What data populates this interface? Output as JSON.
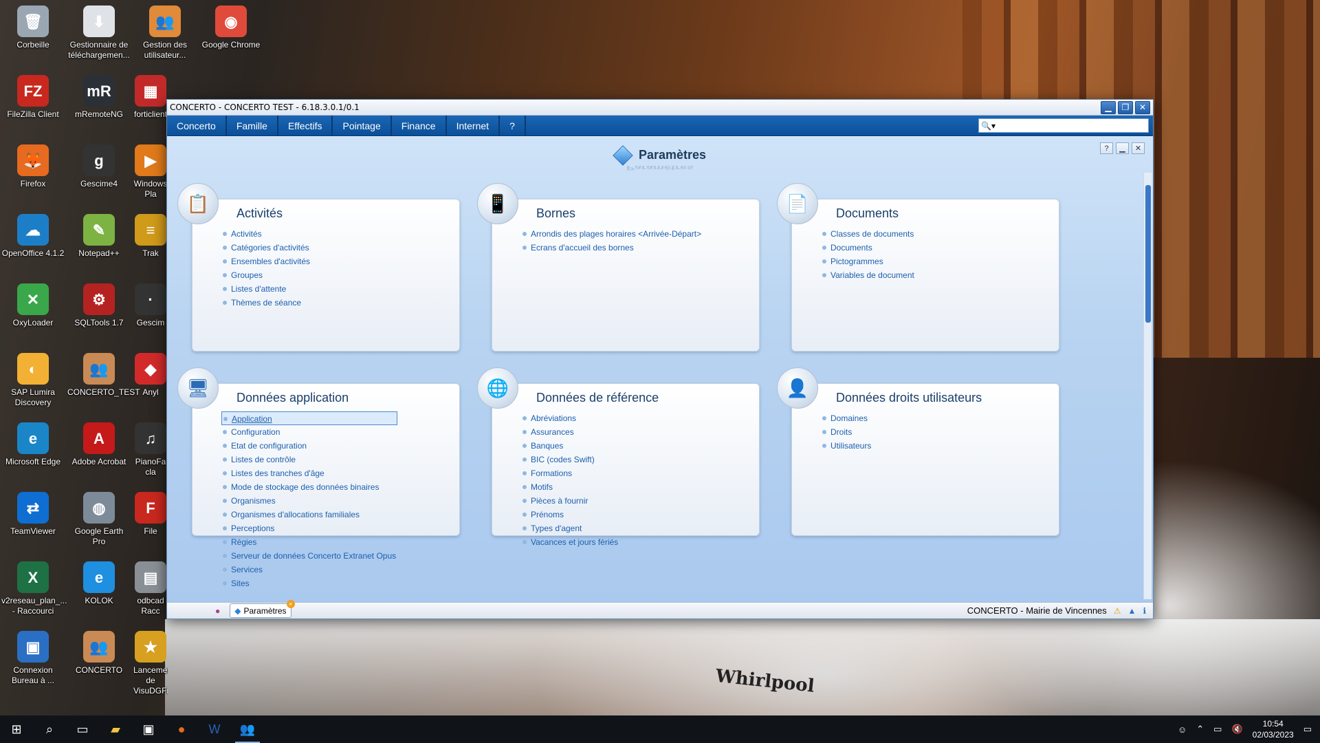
{
  "desktop": {
    "icons": [
      {
        "label": "Corbeille",
        "glyph": "🗑",
        "color": "#9aa7b3"
      },
      {
        "label": "Gestionnaire de téléchargemen...",
        "glyph": "⬇",
        "color": "#dfe3e8"
      },
      {
        "label": "Gestion des utilisateur...",
        "glyph": "👥",
        "color": "#e08a3a"
      },
      {
        "label": "Google Chrome",
        "glyph": "◉",
        "color": "#e04a3a"
      },
      {
        "label": "FileZilla Client",
        "glyph": "FZ",
        "color": "#c8281e"
      },
      {
        "label": "mRemoteNG",
        "glyph": "mR",
        "color": "#2b2f36"
      },
      {
        "label": "forticlient",
        "glyph": "▦",
        "color": "#c22a2a"
      },
      {
        "label": "Firefox",
        "glyph": "🦊",
        "color": "#e66a1f"
      },
      {
        "label": "Gescime4",
        "glyph": "g",
        "color": "#333333"
      },
      {
        "label": "Windows Pla",
        "glyph": "▶",
        "color": "#e07a1a"
      },
      {
        "label": "OpenOffice 4.1.2",
        "glyph": "☁",
        "color": "#1d7ec8"
      },
      {
        "label": "Notepad++",
        "glyph": "✎",
        "color": "#7cb342"
      },
      {
        "label": "Trak",
        "glyph": "≡",
        "color": "#d09a1a"
      },
      {
        "label": "OxyLoader",
        "glyph": "✕",
        "color": "#3aa84a"
      },
      {
        "label": "SQLTools 1.7",
        "glyph": "⚙",
        "color": "#b52222"
      },
      {
        "label": "Gescim",
        "glyph": "·",
        "color": "#333333"
      },
      {
        "label": "SAP Lumira Discovery",
        "glyph": "◐",
        "color": "#f2b134"
      },
      {
        "label": "CONCERTO_TEST",
        "glyph": "👥",
        "color": "#c98a55"
      },
      {
        "label": "Anyl",
        "glyph": "◆",
        "color": "#d22a2a"
      },
      {
        "label": "Microsoft Edge",
        "glyph": "e",
        "color": "#1a86c8"
      },
      {
        "label": "Adobe Acrobat",
        "glyph": "A",
        "color": "#c41a1a"
      },
      {
        "label": "PianoFa cla",
        "glyph": "♫",
        "color": "#333333"
      },
      {
        "label": "TeamViewer",
        "glyph": "⇄",
        "color": "#0e6ed1"
      },
      {
        "label": "Google Earth Pro",
        "glyph": "◍",
        "color": "#7d8b99"
      },
      {
        "label": "File",
        "glyph": "F",
        "color": "#c8281e"
      },
      {
        "label": "v2reseau_plan_... - Raccourci",
        "glyph": "X",
        "color": "#1e7145"
      },
      {
        "label": "KOLOK",
        "glyph": "e",
        "color": "#1f8fe0"
      },
      {
        "label": "odbcad Racc",
        "glyph": "▤",
        "color": "#8a8f96"
      },
      {
        "label": "Connexion Bureau à ...",
        "glyph": "▣",
        "color": "#2a6fc4"
      },
      {
        "label": "CONCERTO",
        "glyph": "👥",
        "color": "#c98a55"
      },
      {
        "label": "Lancement de VisuDGFiP",
        "glyph": "★",
        "color": "#d8a020"
      }
    ]
  },
  "window": {
    "title": "CONCERTO - CONCERTO TEST - 6.18.3.0.1/0.1",
    "menu": [
      "Concerto",
      "Famille",
      "Effectifs",
      "Pointage",
      "Finance",
      "Internet",
      "?"
    ],
    "search": {
      "value": "",
      "icon": "search-icon"
    },
    "page_title": "Paramètres",
    "panels": [
      {
        "title": "Activités",
        "icon": "📋",
        "items": [
          "Activités",
          "Catégories d'activités",
          "Ensembles d'activités",
          "Groupes",
          "Listes d'attente",
          "Thèmes de séance"
        ]
      },
      {
        "title": "Bornes",
        "icon": "📱",
        "items": [
          "Arrondis des plages horaires <Arrivée-Départ>",
          "Ecrans d'accueil des bornes"
        ]
      },
      {
        "title": "Documents",
        "icon": "📄",
        "items": [
          "Classes de documents",
          "Documents",
          "Pictogrammes",
          "Variables de document"
        ]
      },
      {
        "title": "Données application",
        "icon": "🖥",
        "selected": "Application",
        "items": [
          "Application",
          "Configuration",
          "Etat de configuration",
          "Listes de contrôle",
          "Listes des tranches d'âge",
          "Mode de stockage des données binaires",
          "Organismes",
          "Organismes d'allocations familiales",
          "Perceptions",
          "Régies",
          "Serveur de données Concerto Extranet Opus",
          "Services",
          "Sites"
        ]
      },
      {
        "title": "Données de référence",
        "icon": "🌐",
        "items": [
          "Abréviations",
          "Assurances",
          "Banques",
          "BIC (codes Swift)",
          "Formations",
          "Motifs",
          "Pièces à fournir",
          "Prénoms",
          "Types d'agent",
          "Vacances et jours fériés"
        ]
      },
      {
        "title": "Données droits utilisateurs",
        "icon": "👤",
        "items": [
          "Domaines",
          "Droits",
          "Utilisateurs"
        ]
      }
    ],
    "statusbar": {
      "tab_label": "Paramètres",
      "status_text": "CONCERTO - Mairie de Vincennes"
    }
  },
  "taskbar": {
    "time": "10:54",
    "date": "02/03/2023"
  },
  "background_text": "Whirlpool"
}
